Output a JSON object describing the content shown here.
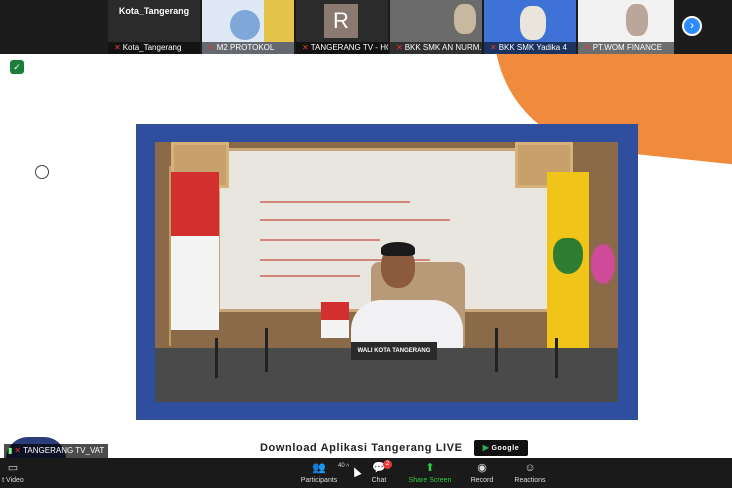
{
  "gallery": {
    "tiles": [
      {
        "title": "Kota_Tangerang",
        "label": "Kota_Tangerang"
      },
      {
        "label": "M2 PROTOKOL"
      },
      {
        "initial": "R",
        "label": "TANGERANG TV - HO..."
      },
      {
        "label": "BKK SMK AN NURM..."
      },
      {
        "label": "BKK SMK Yadika 4"
      },
      {
        "label": "PT.WOM FINANCE"
      }
    ],
    "next_icon": "chevron-right-icon"
  },
  "shared_screen": {
    "download_text": "Download Aplikasi Tangerang LIVE",
    "badge_text": "Google Play",
    "nameplate": "WALI KOTA TANGERANG"
  },
  "self_view": {
    "label": "TANGERANG TV_VAT"
  },
  "toolbar": {
    "video_label": "t Video",
    "participants_label": "Participants",
    "participants_count": "40",
    "chat_label": "Chat",
    "chat_badge": "2",
    "share_label": "Share Screen",
    "record_label": "Record",
    "reactions_label": "Reactions"
  },
  "colors": {
    "accent": "#2d8cff",
    "share_green": "#2ecc40",
    "frame_blue": "#2f4f9e",
    "orange": "#f08a3c",
    "muted_red": "#e53935"
  }
}
